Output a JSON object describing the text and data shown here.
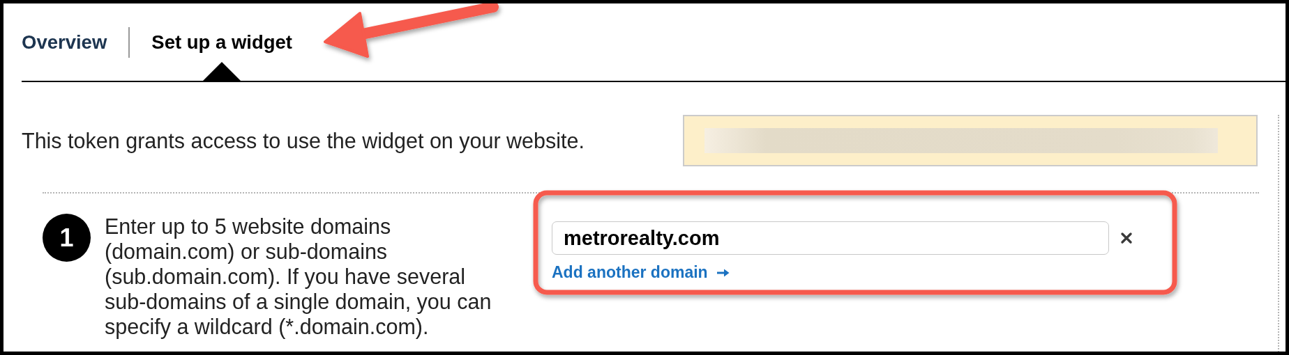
{
  "tabs": [
    {
      "label": "Overview",
      "selected": false
    },
    {
      "label": "Set up a widget",
      "selected": true
    }
  ],
  "token": {
    "description": "This token grants access to use the widget on your website."
  },
  "steps": [
    {
      "number": "1",
      "instructions": "Enter up to 5 website domains\n(domain.com) or sub-domains\n(sub.domain.com). If you have several\nsub-domains of a single domain, you can\nspecify a wildcard (*.domain.com).",
      "domains": [
        {
          "value": "metrorealty.com"
        }
      ],
      "add_link": "Add another domain"
    }
  ]
}
